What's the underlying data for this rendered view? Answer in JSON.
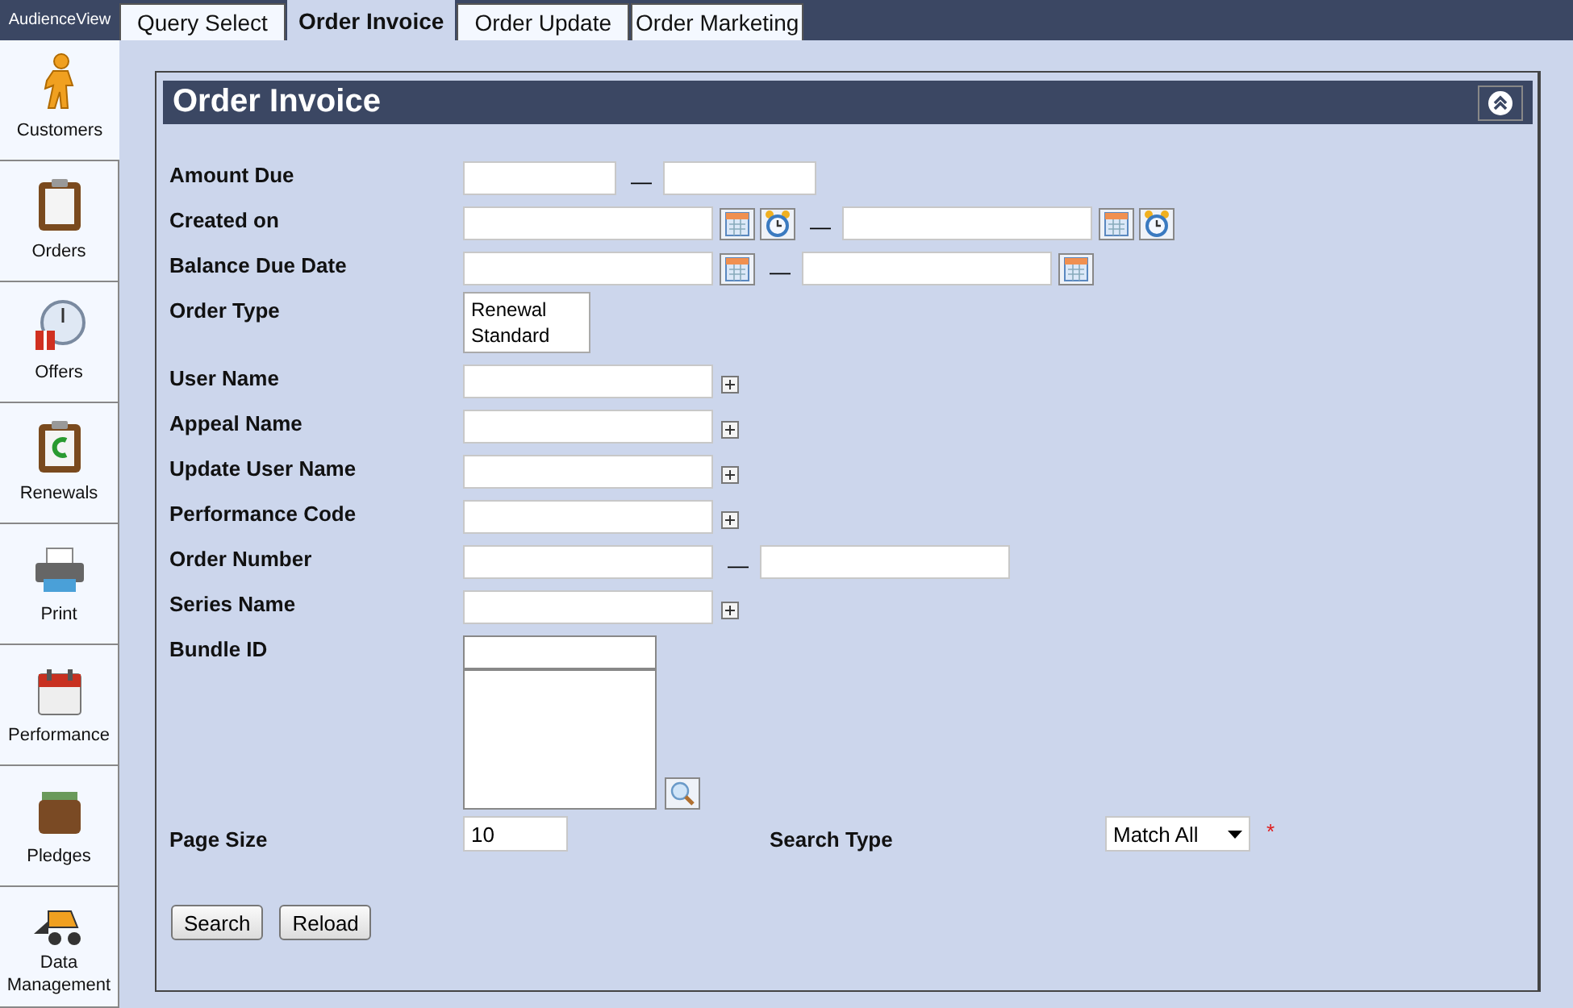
{
  "app_name": "AudienceView",
  "tabs": [
    {
      "label": "Query Select",
      "selected": false
    },
    {
      "label": "Order Invoice",
      "selected": true
    },
    {
      "label": "Order Update",
      "selected": false
    },
    {
      "label": "Order Marketing",
      "selected": false
    }
  ],
  "sidebar": {
    "items": [
      {
        "label": "Customers",
        "selected": true
      },
      {
        "label": "Orders",
        "selected": false
      },
      {
        "label": "Offers",
        "selected": false
      },
      {
        "label": "Renewals",
        "selected": false
      },
      {
        "label": "Print",
        "selected": false
      },
      {
        "label": "Performance",
        "selected": false
      },
      {
        "label": "Pledges",
        "selected": false
      },
      {
        "label": "Data Management",
        "selected": false
      }
    ]
  },
  "panel": {
    "title": "Order Invoice",
    "fields": [
      {
        "label": "Amount Due",
        "kind": "number_range",
        "separator": "—"
      },
      {
        "label": "Created on",
        "kind": "datetime_range",
        "separator": "—"
      },
      {
        "label": "Balance Due Date",
        "kind": "date_range",
        "separator": "—"
      },
      {
        "label": "Order Type",
        "kind": "list",
        "options": [
          "Renewal",
          "Standard"
        ]
      },
      {
        "label": "User Name",
        "kind": "lookup"
      },
      {
        "label": "Appeal Name",
        "kind": "lookup"
      },
      {
        "label": "Update User Name",
        "kind": "lookup"
      },
      {
        "label": "Performance Code",
        "kind": "lookup"
      },
      {
        "label": "Order Number",
        "kind": "range",
        "separator": "—"
      },
      {
        "label": "Series Name",
        "kind": "lookup"
      },
      {
        "label": "Bundle ID",
        "kind": "bundle"
      }
    ],
    "page_size": {
      "label": "Page Size",
      "value": "10"
    },
    "search_type": {
      "label": "Search Type",
      "value": "Match All",
      "required": true,
      "required_mark": "*"
    },
    "buttons": [
      "Search",
      "Reload"
    ]
  }
}
